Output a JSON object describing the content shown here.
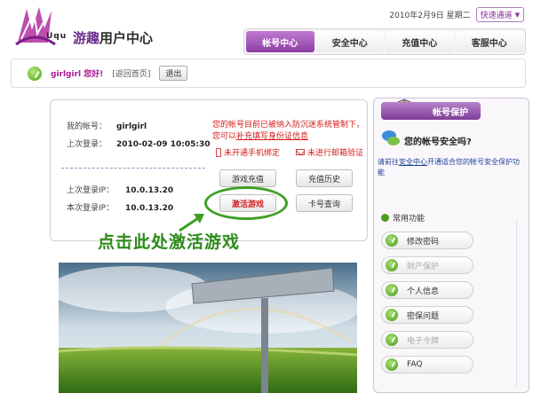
{
  "header": {
    "logo_text": "Uqu",
    "brand_part1": "游趣",
    "brand_part2": "用户中心",
    "date": "2010年2月9日 星期二",
    "quick_label": "快速通道"
  },
  "tabs": [
    {
      "label": "帐号中心",
      "active": true
    },
    {
      "label": "安全中心",
      "active": false
    },
    {
      "label": "充值中心",
      "active": false
    },
    {
      "label": "客服中心",
      "active": false
    }
  ],
  "userbar": {
    "greeting": "girlgirl 您好!",
    "home_link": "[返回首页]",
    "logout": "退出"
  },
  "account": {
    "my_account_label": "我的帐号：",
    "my_account_value": "girlgirl",
    "last_login_label": "上次登录：",
    "last_login_value": "2010-02-09 10:05:30",
    "last_ip_label": "上次登录IP：",
    "last_ip_value": "10.0.13.20",
    "this_ip_label": "本次登录IP：",
    "this_ip_value": "10.0.13.20",
    "warning_pre": "您的帐号目前已被纳入防沉迷系统管制下，您可以",
    "warning_link": "补充填写身份证信息",
    "phone_status": "未开通手机绑定",
    "mail_status": "未进行邮箱验证"
  },
  "actions": {
    "recharge": "游戏充值",
    "history": "充值历史",
    "activate": "激活游戏",
    "card_query": "卡号查询"
  },
  "callout": "点击此处激活游戏",
  "sidebar": {
    "title": "帐号保护",
    "safe_question": "您的帐号安全吗?",
    "desc_pre": "请前往",
    "desc_link": "安全中心",
    "desc_post": "开通适合您的帐号安全保护功能",
    "functions_title": "常用功能",
    "functions": [
      {
        "label": "修改密码",
        "enabled": true
      },
      {
        "label": "财产保护",
        "enabled": false
      },
      {
        "label": "个人信息",
        "enabled": true
      },
      {
        "label": "密保问题",
        "enabled": true
      },
      {
        "label": "电子令牌",
        "enabled": false
      },
      {
        "label": "FAQ",
        "enabled": true
      }
    ]
  },
  "colors": {
    "brand_purple": "#8d3ea4",
    "alert_red": "#d41a1a",
    "callout_green": "#2e8a1a"
  }
}
